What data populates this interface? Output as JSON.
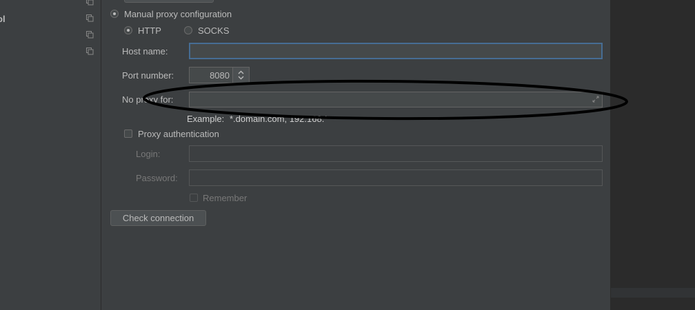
{
  "sidebar": {
    "items": [
      {
        "label": ""
      },
      {
        "label": "ol"
      },
      {
        "label": ""
      },
      {
        "label": ""
      }
    ]
  },
  "proxy": {
    "manual_label": "Manual proxy configuration",
    "http_label": "HTTP",
    "socks_label": "SOCKS",
    "host_label": "Host name:",
    "host_value": "",
    "port_label": "Port number:",
    "port_value": "8080",
    "no_proxy_label": "No proxy for:",
    "no_proxy_value": "",
    "example_label": "Example:",
    "example_value": "*.domain.com, 192.168.*",
    "auth_label": "Proxy authentication",
    "login_label": "Login:",
    "login_value": "",
    "password_label": "Password:",
    "password_value": "",
    "remember_label": "Remember",
    "check_button_label": "Check connection"
  },
  "colors": {
    "background": "#3c3f41",
    "focus_border": "#466d94",
    "text": "#bbbbbb",
    "annotation": "#000000"
  }
}
